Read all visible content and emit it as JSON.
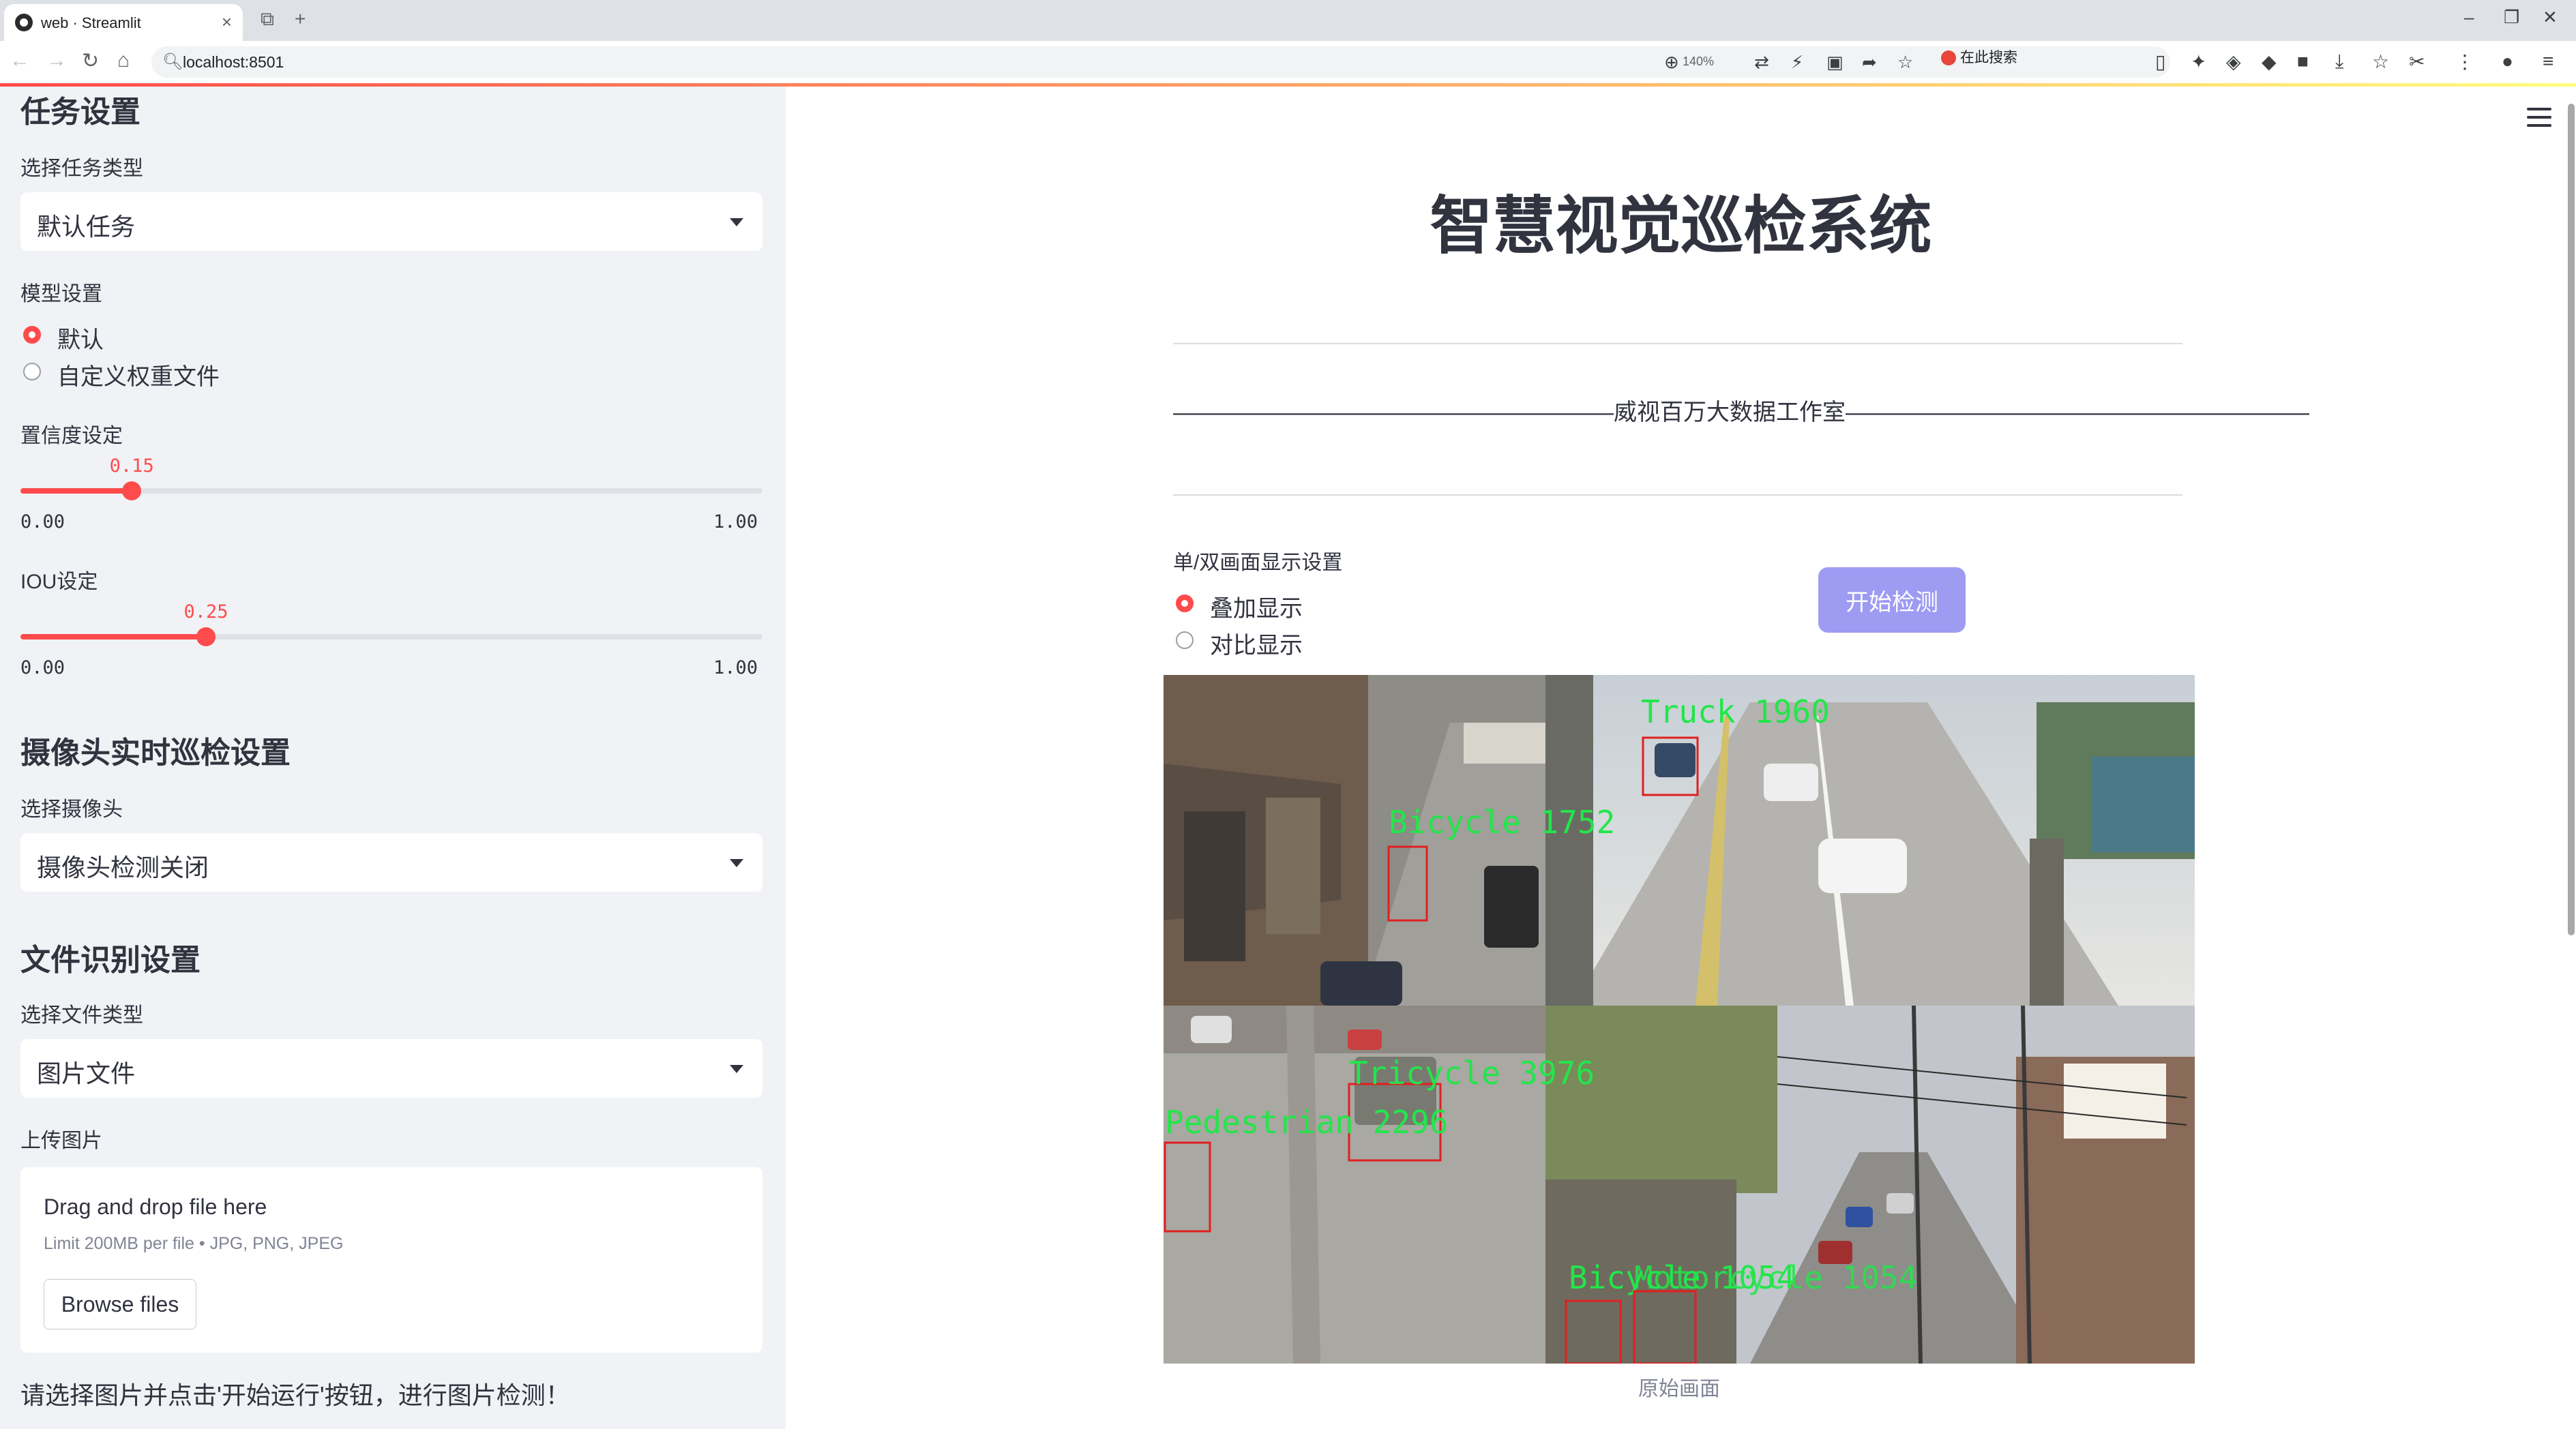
{
  "browser": {
    "tab_title": "web · Streamlit",
    "url": "localhost:8501",
    "zoom": "140%",
    "search_engine": "在此搜索"
  },
  "sidebar": {
    "task_section": "任务设置",
    "task_type_label": "选择任务类型",
    "task_type_value": "默认任务",
    "model_label": "模型设置",
    "model_options": [
      "默认",
      "自定义权重文件"
    ],
    "model_selected": 0,
    "confidence": {
      "label": "置信度设定",
      "value": "0.15",
      "fraction": 0.15,
      "min": "0.00",
      "max": "1.00"
    },
    "iou": {
      "label": "IOU设定",
      "value": "0.25",
      "fraction": 0.25,
      "min": "0.00",
      "max": "1.00"
    },
    "camera_section": "摄像头实时巡检设置",
    "camera_label": "选择摄像头",
    "camera_value": "摄像头检测关闭",
    "file_section": "文件识别设置",
    "file_type_label": "选择文件类型",
    "file_type_value": "图片文件",
    "upload_label": "上传图片",
    "uploader": {
      "drag_text": "Drag and drop file here",
      "limit_text": "Limit 200MB per file • JPG, PNG, JPEG",
      "browse_label": "Browse files"
    },
    "hint": "请选择图片并点击'开始运行'按钮，进行图片检测！"
  },
  "main": {
    "title": "智慧视觉巡检系统",
    "studio_line": "———————————————————威视百万大数据工作室————————————————————",
    "display_label": "单/双画面显示设置",
    "display_options": [
      "叠加显示",
      "对比显示"
    ],
    "display_selected": 0,
    "start_button": "开始检测",
    "caption": "原始画面",
    "detections": [
      {
        "label": "Truck 1960"
      },
      {
        "label": "Bicycle 1752"
      },
      {
        "label": "Tricycle 3976"
      },
      {
        "label": "Pedestrian 2296"
      },
      {
        "label": "Bicycle 1054"
      },
      {
        "label": "Motorcycle 1054"
      }
    ]
  },
  "colors": {
    "accent": "#ff4b4b",
    "button": "#9d9bf2",
    "sidebar_bg": "#f0f2f6",
    "detection_box": "#e02020",
    "detection_text": "#22e64a"
  }
}
